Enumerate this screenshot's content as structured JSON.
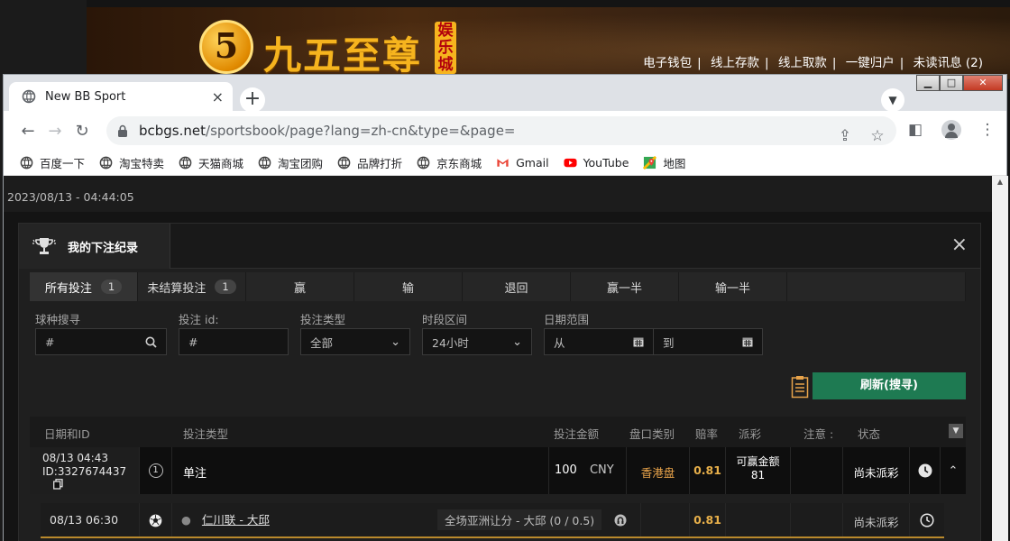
{
  "site": {
    "logo_mark": "5",
    "logo_text": "九五至尊",
    "logo_badge": "娱乐城",
    "top_links": [
      "电子钱包",
      "线上存款",
      "线上取款",
      "一键归户",
      "未读讯息 (2)"
    ]
  },
  "browser": {
    "tab_title": "New BB Sport",
    "tab_close": "×",
    "new_tab": "+",
    "url_host": "bcbgs.net",
    "url_path": "/sportsbook/page?lang=zh-cn&type=&page=",
    "bookmarks": [
      {
        "label": "百度一下",
        "icon": "globe-icon"
      },
      {
        "label": "淘宝特卖",
        "icon": "globe-icon"
      },
      {
        "label": "天猫商城",
        "icon": "globe-icon"
      },
      {
        "label": "淘宝团购",
        "icon": "globe-icon"
      },
      {
        "label": "品牌打折",
        "icon": "globe-icon"
      },
      {
        "label": "京东商城",
        "icon": "globe-icon"
      },
      {
        "label": "Gmail",
        "icon": "gmail-icon"
      },
      {
        "label": "YouTube",
        "icon": "youtube-icon"
      },
      {
        "label": "地图",
        "icon": "maps-icon"
      }
    ]
  },
  "page": {
    "datetime": "2023/08/13 - 04:44:05"
  },
  "modal": {
    "title": "我的下注纪录",
    "close": "×",
    "filter_tabs": [
      {
        "label": "所有投注",
        "count": "1"
      },
      {
        "label": "未结算投注",
        "count": "1"
      },
      {
        "label": "赢"
      },
      {
        "label": "输"
      },
      {
        "label": "退回"
      },
      {
        "label": "赢一半"
      },
      {
        "label": "输一半"
      }
    ],
    "filters": {
      "sport_label": "球种搜寻",
      "sport_placeholder": "#",
      "betid_label": "投注 id:",
      "betid_placeholder": "#",
      "bettype_label": "投注类型",
      "bettype_value": "全部",
      "period_label": "时段区间",
      "period_value": "24小时",
      "daterange_label": "日期范围",
      "from_placeholder": "从",
      "to_placeholder": "到"
    },
    "refresh_label": "刷新(搜寻)",
    "table": {
      "headers": {
        "date_id": "日期和ID",
        "bet_type": "投注类型",
        "amount": "投注金额",
        "odds_type": "盘口类别",
        "odds": "赔率",
        "payout": "派彩",
        "note": "注意 :",
        "status": "状态"
      },
      "bet": {
        "date": "08/13 04:43",
        "id": "ID:3327674437",
        "index": "1",
        "type": "单注",
        "amount": "100",
        "currency": "CNY",
        "odds_type": "香港盘",
        "odds": "0.81",
        "payout_label": "可赢金额",
        "payout_value": "81",
        "status": "尚未派彩"
      },
      "selection": {
        "time": "08/13 06:30",
        "match": "仁川联 - 大邱",
        "market": "全场亚洲让分 - 大邱 (0 / 0.5)",
        "odds": "0.81",
        "status": "尚未派彩"
      }
    }
  },
  "colors": {
    "accent_green": "#1e7a52",
    "odds_gold": "#e8b04a",
    "hk_orange": "#e8a34a"
  }
}
